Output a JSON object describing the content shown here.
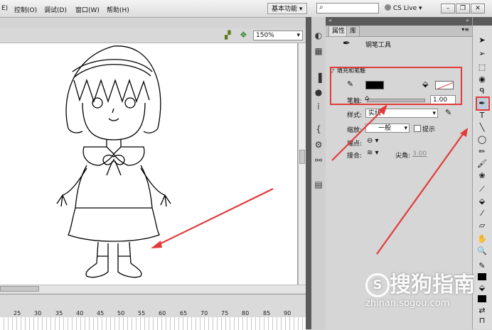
{
  "menubar": {
    "items": [
      "E)",
      "控制(O)",
      "调试(D)",
      "窗口(W)",
      "帮助(H)"
    ],
    "workspace_label": "基本功能",
    "cslive_label": "CS Live"
  },
  "stage": {
    "zoom": "150%"
  },
  "timeline": {
    "frame_numbers": [
      "25",
      "30",
      "35",
      "40",
      "45",
      "50",
      "55",
      "60",
      "65",
      "70",
      "75",
      "80",
      "85",
      "90"
    ]
  },
  "properties": {
    "tab_properties": "属性",
    "tab_library": "库",
    "tool_name": "钢笔工具",
    "section_title": "填充和笔触",
    "stroke_label": "笔触:",
    "stroke_value": "1.00",
    "style_label": "样式:",
    "style_value": "实线",
    "scale_label": "缩放:",
    "scale_value": "一般",
    "hint_label": "提示",
    "cap_label": "端点:",
    "join_label": "接合:",
    "miter_label": "尖角:",
    "miter_value": "3.00",
    "stroke_color": "#000000",
    "fill_color": "none"
  },
  "watermark": {
    "brand": "搜狗指南",
    "url": "zhinan.sogou.com"
  },
  "colors": {
    "highlight": "#e23b3b",
    "arrow": "#e23b3b"
  }
}
